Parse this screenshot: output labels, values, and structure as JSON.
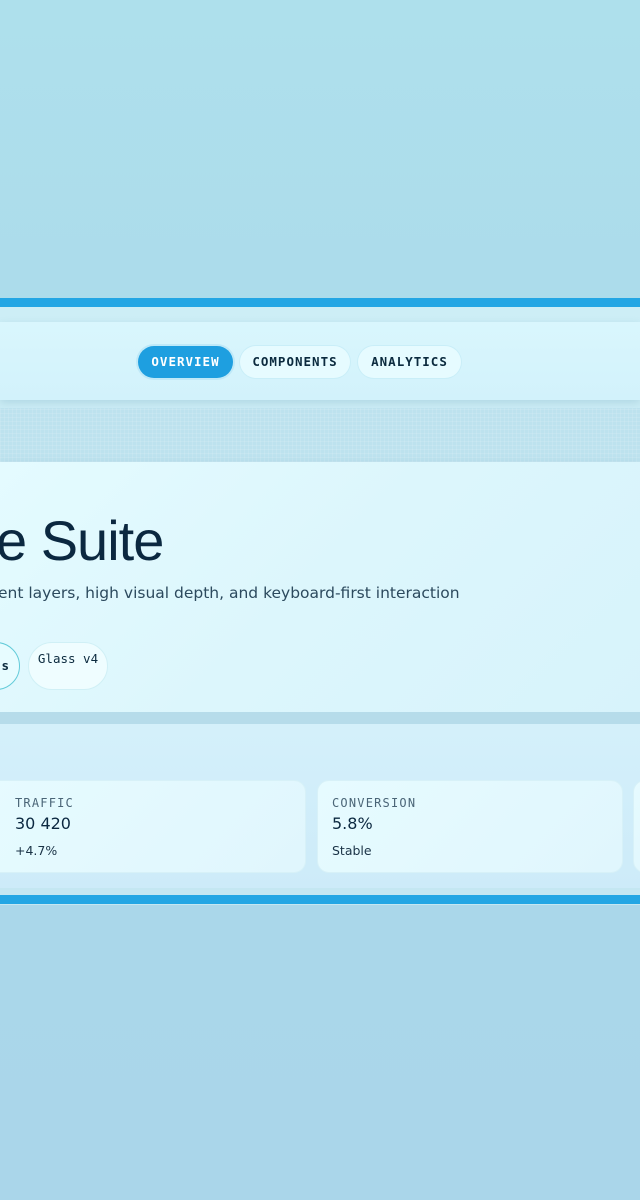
{
  "nav": {
    "tabs": [
      {
        "label": "OVERVIEW",
        "active": true
      },
      {
        "label": "COMPONENTS",
        "active": false
      },
      {
        "label": "ANALYTICS",
        "active": false
      }
    ]
  },
  "hero": {
    "title": "e Suite",
    "subtitle": "ent layers, high visual depth, and keyboard-first interaction",
    "chips": [
      "s",
      "Glass v4"
    ]
  },
  "stats": {
    "cards": [
      {
        "label": "TRAFFIC",
        "value": "30 420",
        "delta": "+4.7%"
      },
      {
        "label": "CONVERSION",
        "value": "5.8%",
        "delta": "Stable"
      }
    ]
  },
  "colors": {
    "accent": "#23a6e4",
    "active_tab": "#1e9fe0",
    "text_dark": "#0b2840",
    "background": "#acdceb"
  }
}
